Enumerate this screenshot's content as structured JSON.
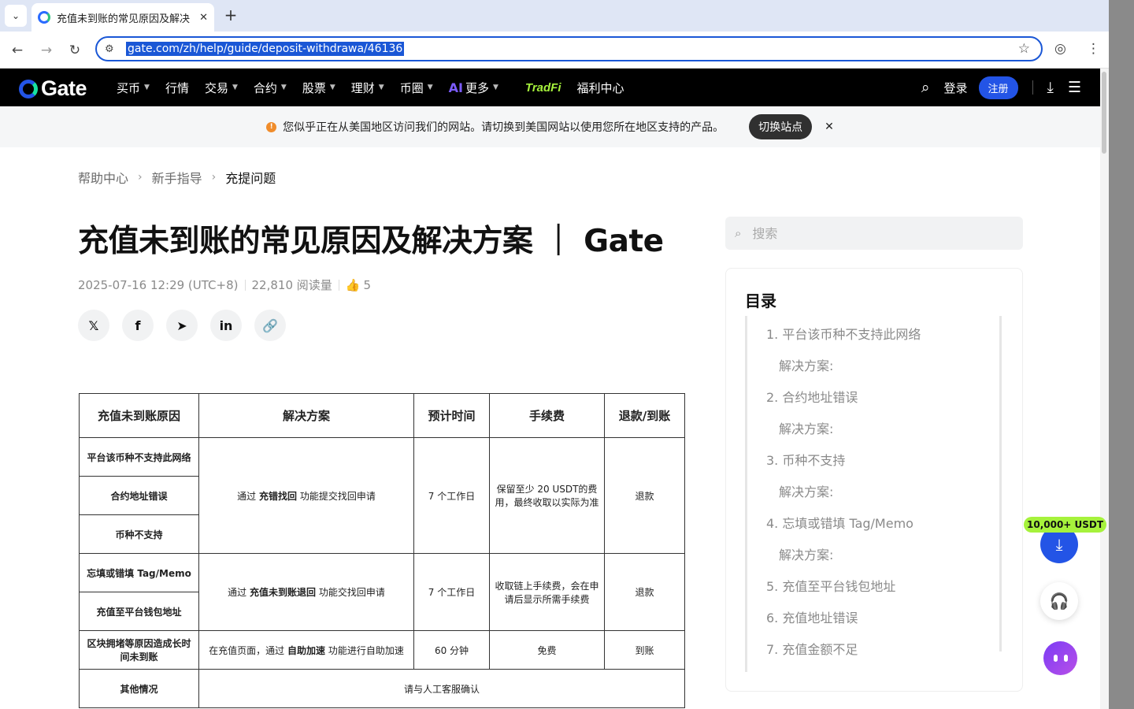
{
  "browser": {
    "tab_title": "充值未到账的常见原因及解决",
    "tab_close": "✕",
    "new_tab": "+",
    "url": "gate.com/zh/help/guide/deposit-withdrawa/46136"
  },
  "site": {
    "logo": "Gate",
    "nav": [
      {
        "label": "买币",
        "caret": true
      },
      {
        "label": "行情",
        "caret": false
      },
      {
        "label": "交易",
        "caret": true
      },
      {
        "label": "合约",
        "caret": true
      },
      {
        "label": "股票",
        "caret": true
      },
      {
        "label": "理财",
        "caret": true
      },
      {
        "label": "币圈",
        "caret": true
      },
      {
        "label": "更多",
        "caret": true,
        "prefix": "AI"
      },
      {
        "label": "TradFi",
        "caret": false
      },
      {
        "label": "福利中心",
        "caret": false
      }
    ],
    "login": "登录",
    "signup": "注册"
  },
  "notice": {
    "text": "您似乎正在从美国地区访问我们的网站。请切换到美国网站以使用您所在地区支持的产品。",
    "button": "切换站点",
    "close": "✕",
    "icon": "!"
  },
  "breadcrumb": [
    "帮助中心",
    "新手指导",
    "充提问题"
  ],
  "article": {
    "title": "充值未到账的常见原因及解决方案 ｜ Gate",
    "date": "2025-07-16 12:29 (UTC+8)",
    "views": "22,810 阅读量",
    "likes": "5",
    "share": [
      "x",
      "facebook",
      "telegram",
      "linkedin",
      "link"
    ]
  },
  "table": {
    "headers": [
      "充值未到账原因",
      "解决方案",
      "预计时间",
      "手续费",
      "退款/到账"
    ],
    "rows": [
      {
        "reason": "平台该币种不支持此网络"
      },
      {
        "reason": "合约地址错误"
      },
      {
        "reason": "币种不支持"
      },
      {
        "reason": "忘填或错填 Tag/Memo"
      },
      {
        "reason": "充值至平台钱包地址"
      },
      {
        "reason": "区块拥堵等原因造成长时间未到账"
      },
      {
        "reason": "其他情况"
      }
    ],
    "group1": {
      "solution_pre": "通过 ",
      "solution_bold": "充错找回",
      "solution_post": " 功能提交找回申请",
      "time": "7 个工作日",
      "fee": "保留至少 20 USDT的费用，最终收取以实际为准",
      "result": "退款"
    },
    "group2": {
      "solution_pre": "通过 ",
      "solution_bold": "充值未到账退回",
      "solution_post": " 功能交找回申请",
      "time": "7 个工作日",
      "fee": "收取链上手续费，会在申请后显示所需手续费",
      "result": "退款"
    },
    "group3": {
      "solution_pre": "在充值页面，通过 ",
      "solution_bold": "自助加速",
      "solution_post": " 功能进行自助加速",
      "time": "60 分钟",
      "fee": "免费",
      "result": "到账"
    },
    "group4": {
      "solution": "请与人工客服确认"
    }
  },
  "sidebar": {
    "search_placeholder": "搜索",
    "toc_title": "目录",
    "toc": [
      {
        "label": "1. 平台该币种不支持此网络",
        "sub": false
      },
      {
        "label": "解决方案:",
        "sub": true
      },
      {
        "label": "2. 合约地址错误",
        "sub": false
      },
      {
        "label": "解决方案:",
        "sub": true
      },
      {
        "label": "3. 币种不支持",
        "sub": false
      },
      {
        "label": "解决方案:",
        "sub": true
      },
      {
        "label": "4. 忘填或错填 Tag/Memo",
        "sub": false
      },
      {
        "label": "解决方案:",
        "sub": true
      },
      {
        "label": "5. 充值至平台钱包地址",
        "sub": false
      },
      {
        "label": "6. 充值地址错误",
        "sub": false
      },
      {
        "label": "7. 充值金额不足",
        "sub": false
      }
    ]
  },
  "floating": {
    "badge": "10,000+ USDT"
  },
  "colors": {
    "brand_blue": "#2354e6",
    "brand_green": "#a6f23c",
    "header_bg": "#000000"
  }
}
